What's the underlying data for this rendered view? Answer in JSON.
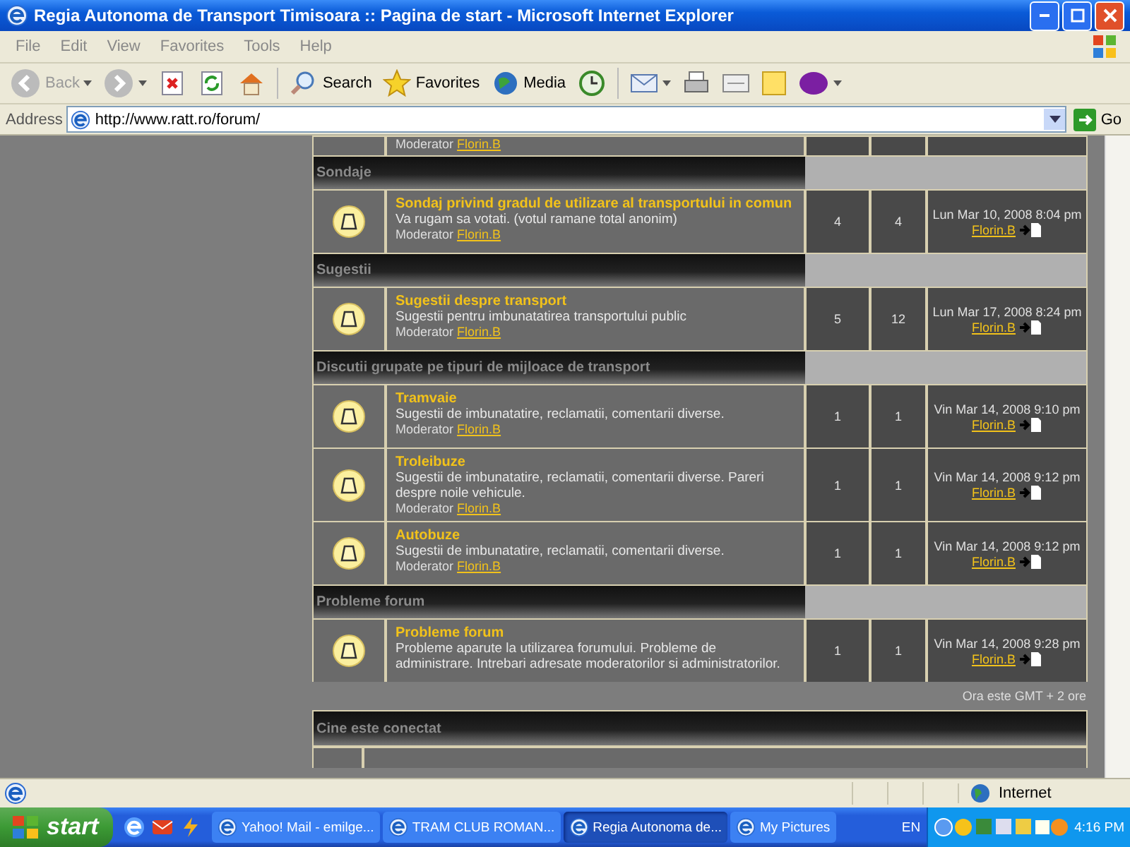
{
  "window": {
    "title": "Regia Autonoma de Transport Timisoara :: Pagina de start - Microsoft Internet Explorer"
  },
  "menu": [
    "File",
    "Edit",
    "View",
    "Favorites",
    "Tools",
    "Help"
  ],
  "toolbar": [
    {
      "kind": "back",
      "label": "Back",
      "disabled": true
    },
    {
      "kind": "forward",
      "disabled": true
    },
    {
      "kind": "stop"
    },
    {
      "kind": "refresh"
    },
    {
      "kind": "home"
    },
    {
      "kind": "search",
      "label": "Search"
    },
    {
      "kind": "favorites",
      "label": "Favorites"
    },
    {
      "kind": "media",
      "label": "Media"
    },
    {
      "kind": "history"
    },
    {
      "kind": "mail"
    },
    {
      "kind": "print"
    },
    {
      "kind": "edit"
    },
    {
      "kind": "note"
    },
    {
      "kind": "yahoo"
    }
  ],
  "address": {
    "label": "Address",
    "value": "http://www.ratt.ro/forum/",
    "go": "Go"
  },
  "forum": {
    "top_row": {
      "moderator_label": "Moderator",
      "moderator": "Florin.B"
    },
    "sections": [
      {
        "title": "Sondaje",
        "forums": [
          {
            "name": "Sondaj privind gradul de utilizare al transportului in comun",
            "description": "Va rugam sa votati. (votul ramane total anonim)",
            "moderator_label": "Moderator",
            "moderator": "Florin.B",
            "topics": "4",
            "posts": "4",
            "last_post_date": "Lun Mar 10, 2008 8:04 pm",
            "last_post_user": "Florin.B"
          }
        ]
      },
      {
        "title": "Sugestii",
        "forums": [
          {
            "name": "Sugestii despre transport",
            "description": "Sugestii pentru imbunatatirea transportului public",
            "moderator_label": "Moderator",
            "moderator": "Florin.B",
            "topics": "5",
            "posts": "12",
            "last_post_date": "Lun Mar 17, 2008 8:24 pm",
            "last_post_user": "Florin.B"
          }
        ]
      },
      {
        "title": "Discutii grupate pe tipuri de mijloace de transport",
        "forums": [
          {
            "name": "Tramvaie",
            "description": "Sugestii de imbunatatire, reclamatii, comentarii diverse.",
            "moderator_label": "Moderator",
            "moderator": "Florin.B",
            "topics": "1",
            "posts": "1",
            "last_post_date": "Vin Mar 14, 2008 9:10 pm",
            "last_post_user": "Florin.B"
          },
          {
            "name": "Troleibuze",
            "description": "Sugestii de imbunatatire, reclamatii, comentarii diverse. Pareri despre noile vehicule.",
            "moderator_label": "Moderator",
            "moderator": "Florin.B",
            "topics": "1",
            "posts": "1",
            "last_post_date": "Vin Mar 14, 2008 9:12 pm",
            "last_post_user": "Florin.B"
          },
          {
            "name": "Autobuze",
            "description": "Sugestii de imbunatatire, reclamatii, comentarii diverse.",
            "moderator_label": "Moderator",
            "moderator": "Florin.B",
            "topics": "1",
            "posts": "1",
            "last_post_date": "Vin Mar 14, 2008 9:12 pm",
            "last_post_user": "Florin.B"
          }
        ]
      },
      {
        "title": "Probleme forum",
        "forums": [
          {
            "name": "Probleme forum",
            "description": "Probleme aparute la utilizarea forumului. Probleme de administrare. Intrebari adresate moderatorilor si administratorilor.",
            "topics": "1",
            "posts": "1",
            "last_post_date": "Vin Mar 14, 2008 9:28 pm",
            "last_post_user": "Florin.B"
          }
        ]
      }
    ],
    "timezone": "Ora este GMT + 2 ore",
    "online_title": "Cine este conectat"
  },
  "status_bar": {
    "zone": "Internet"
  },
  "taskbar": {
    "start": "start",
    "tasks": [
      {
        "label": "Yahoo! Mail - emilge...",
        "selected": false
      },
      {
        "label": "TRAM CLUB ROMAN...",
        "selected": false
      },
      {
        "label": "Regia Autonoma de...",
        "selected": true
      },
      {
        "label": "My Pictures",
        "selected": false
      }
    ],
    "language": "EN",
    "clock": "4:16 PM"
  }
}
